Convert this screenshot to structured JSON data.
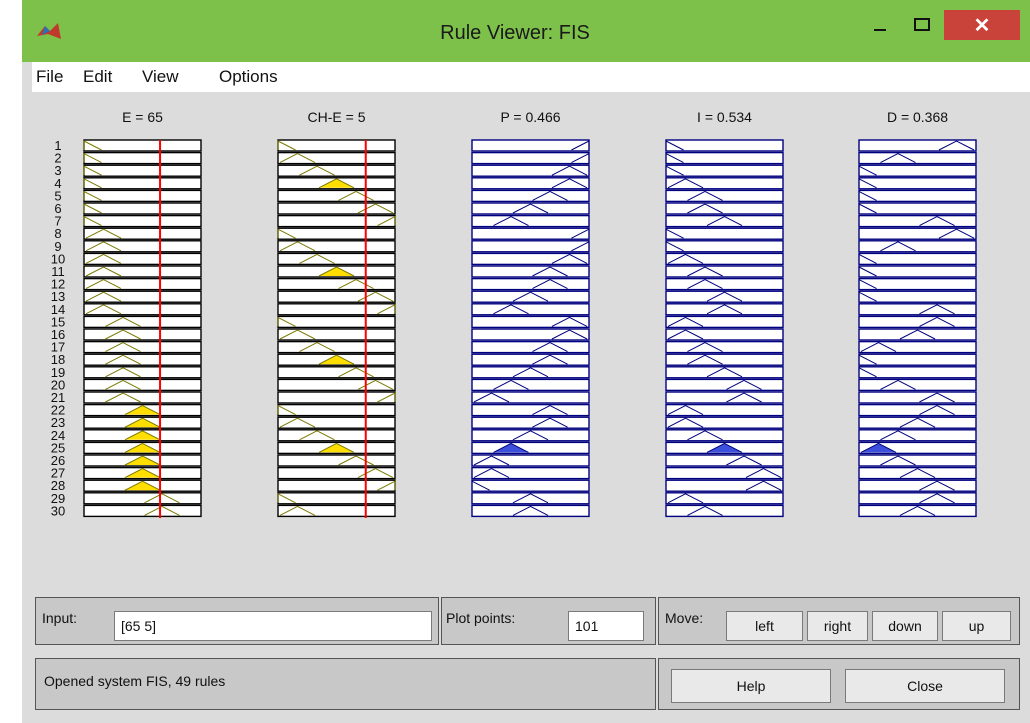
{
  "window": {
    "title": "Rule Viewer: FIS",
    "minimize_icon": "minimize-icon",
    "maximize_icon": "maximize-icon",
    "close_label": "✕",
    "close_icon": "close-icon"
  },
  "menu": [
    "File",
    "Edit",
    "View",
    "Options"
  ],
  "columns": [
    {
      "label": "E = 65",
      "kind": "input",
      "value_line": 65,
      "range": [
        0,
        100
      ]
    },
    {
      "label": "CH-E = 5",
      "kind": "input",
      "value_line": 5,
      "range": [
        -10,
        10
      ]
    },
    {
      "label": "P = 0.466",
      "kind": "output"
    },
    {
      "label": "I = 0.534",
      "kind": "output"
    },
    {
      "label": "D = 0.368",
      "kind": "output"
    }
  ],
  "rule_numbers": [
    "1",
    "2",
    "3",
    "4",
    "5",
    "6",
    "7",
    "8",
    "9",
    "10",
    "11",
    "12",
    "13",
    "14",
    "15",
    "16",
    "17",
    "18",
    "19",
    "20",
    "21",
    "22",
    "23",
    "24",
    "25",
    "26",
    "27",
    "28",
    "29",
    "30"
  ],
  "rules": {
    "e_mf": [
      0,
      0,
      0,
      0,
      0,
      0,
      0,
      1,
      1,
      1,
      1,
      1,
      1,
      1,
      2,
      2,
      2,
      2,
      2,
      2,
      2,
      3,
      3,
      3,
      3,
      3,
      3,
      3,
      4,
      4
    ],
    "ch_mf": [
      0,
      1,
      2,
      3,
      4,
      5,
      6,
      0,
      1,
      2,
      3,
      4,
      5,
      6,
      0,
      1,
      2,
      3,
      4,
      5,
      6,
      0,
      1,
      2,
      3,
      4,
      5,
      6,
      0,
      1
    ],
    "p_mf": [
      6,
      6,
      5,
      5,
      4,
      3,
      2,
      6,
      6,
      5,
      4,
      4,
      3,
      2,
      5,
      5,
      4,
      4,
      3,
      2,
      1,
      4,
      4,
      3,
      2,
      1,
      1,
      0,
      3,
      3
    ],
    "i_mf": [
      0,
      0,
      0,
      1,
      2,
      2,
      3,
      0,
      0,
      1,
      2,
      2,
      3,
      3,
      1,
      1,
      2,
      2,
      3,
      4,
      4,
      1,
      1,
      2,
      3,
      4,
      5,
      5,
      1,
      2
    ],
    "d_mf": [
      5,
      2,
      0,
      0,
      0,
      0,
      4,
      5,
      2,
      0,
      0,
      0,
      0,
      4,
      4,
      3,
      1,
      0,
      0,
      2,
      4,
      4,
      3,
      2,
      1,
      2,
      3,
      4,
      4,
      3
    ],
    "fired": [
      22,
      23,
      24,
      25,
      26,
      27,
      28
    ],
    "max_output_rule": 25
  },
  "colors": {
    "input_mf": "#7a7a00",
    "fired_fill": "#ffde00",
    "output_mf": "#000080",
    "output_fill": "#3c50dc",
    "value_line": "#ff0000"
  },
  "controls": {
    "input_label": "Input:",
    "input_value": "[65 5]",
    "plot_points_label": "Plot points:",
    "plot_points_value": "101",
    "move_label": "Move:",
    "move_buttons": [
      "left",
      "right",
      "down",
      "up"
    ],
    "status": "Opened system FIS, 49 rules",
    "help_label": "Help",
    "close_label": "Close"
  }
}
